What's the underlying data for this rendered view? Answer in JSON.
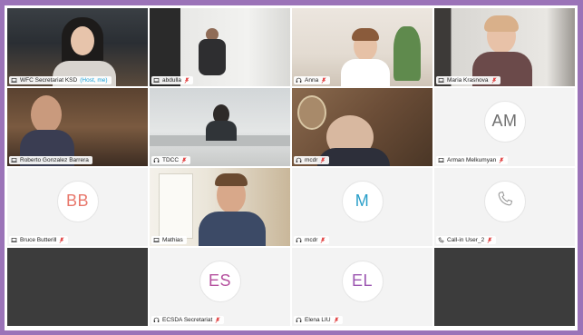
{
  "colors": {
    "frame_border": "#9b73b8",
    "active_speaker": "#3dbde6",
    "mic_muted": "#e03a3a",
    "bb": "#e8776b",
    "am": "#707070",
    "m": "#2a9fc9",
    "es": "#b5509e",
    "el": "#9c56b1"
  },
  "participants": [
    {
      "name": "WFC Secretariat KSD",
      "suffix": "(Host, me)",
      "device": "laptop-icon",
      "muted": false
    },
    {
      "name": "abdulla",
      "device": "laptop-icon",
      "muted": true
    },
    {
      "name": "Anna",
      "device": "headset-icon",
      "muted": true
    },
    {
      "name": "Maria Krasnova",
      "device": "laptop-icon",
      "muted": true
    },
    {
      "name": "Roberto Gonzalez Barrera",
      "device": "laptop-icon",
      "muted": false
    },
    {
      "name": "TDCC",
      "device": "headset-icon",
      "muted": true
    },
    {
      "name": "mcdr",
      "device": "headset-icon",
      "muted": true
    },
    {
      "name": "Arman Melkumyan",
      "initials": "AM",
      "device": "laptop-icon",
      "muted": true
    },
    {
      "name": "Bruce Butterill",
      "initials": "BB",
      "device": "laptop-icon",
      "muted": true
    },
    {
      "name": "Mathias",
      "device": "laptop-icon",
      "muted": false
    },
    {
      "name": "mcdr",
      "initials": "M",
      "device": "headset-icon",
      "muted": true
    },
    {
      "name": "Call-in User_2",
      "device": "phone-icon",
      "muted": true
    },
    {
      "name": "ECSDA Secretariat",
      "initials": "ES",
      "device": "headset-icon",
      "muted": true
    },
    {
      "name": "Elena LIU",
      "initials": "EL",
      "device": "headset-icon",
      "muted": true
    }
  ]
}
